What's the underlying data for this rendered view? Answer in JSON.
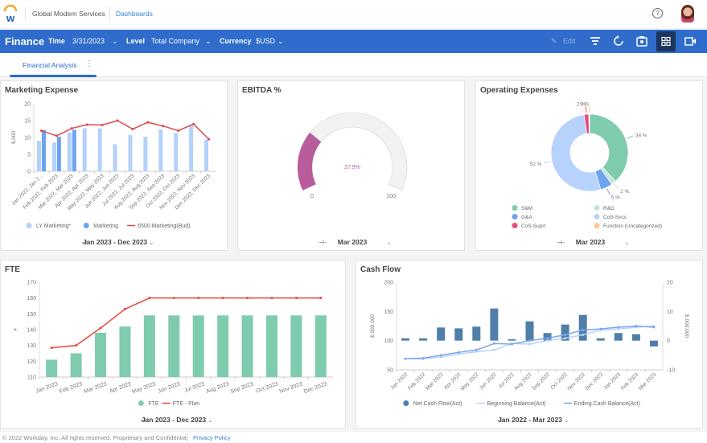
{
  "header": {
    "company": "Global Modern Services",
    "nav_link": "Dashboards",
    "help_icon": "question-circle-icon",
    "avatar": "user-avatar"
  },
  "toolbar": {
    "title": "Finance",
    "time_label": "Time",
    "time_value": "3/31/2023",
    "level_label": "Level",
    "level_value": "Total Company",
    "currency_label": "Currency",
    "currency_value": "$USD",
    "edit_label": "Edit",
    "icons": [
      "pencil-icon",
      "filter-icon",
      "refresh-icon",
      "camera-icon",
      "grid-view-icon",
      "video-icon"
    ],
    "color": "#2f6ccb"
  },
  "tabs": [
    {
      "label": "Financial Analysis",
      "active": true
    }
  ],
  "footer": {
    "copyright": "© 2022 Workday, Inc. All rights reserved. Proprietary and Confidential",
    "privacy": "Privacy Policy"
  },
  "chart_data": [
    {
      "type": "bar",
      "title": "Marketing Expense",
      "ylabel": "$,000",
      "ylim": [
        0,
        20
      ],
      "yticks": [
        "0",
        "5",
        "10",
        "15",
        "20"
      ],
      "categories": [
        "Jan 2022, Jan 2...",
        "Feb 2022, Feb 2023",
        "Mar 2022, Mar 2023",
        "Apr 2022, Apr 2023",
        "May 2022, May 2023",
        "Jun 2022, Jun 2023",
        "Jul 2022, Jul 2023",
        "Aug 2022, Aug 2023",
        "Sep 2022, Sep 2023",
        "Oct 2022, Oct 2023",
        "Nov 2022, Nov 2023",
        "Dec 2022, Dec 2023"
      ],
      "series": [
        {
          "name": "LY Marketing*",
          "type": "bar",
          "color": "#b3d1fb",
          "values": [
            9,
            8.5,
            11.5,
            12.7,
            12.7,
            8,
            10.7,
            10.2,
            12.4,
            11.3,
            13.5,
            9.4
          ]
        },
        {
          "name": "Marketing",
          "type": "bar",
          "color": "#6ea3f0",
          "values": [
            12.2,
            10.2,
            12.3,
            null,
            null,
            null,
            null,
            null,
            null,
            null,
            null,
            null
          ]
        },
        {
          "name": "6500 Marketing(Bud)",
          "type": "line",
          "color": "#e0474c",
          "values": [
            12,
            10.5,
            12.7,
            13.8,
            13.7,
            15,
            12.5,
            14.5,
            13.4,
            12,
            14,
            9.5
          ]
        }
      ],
      "legend": "bottom",
      "period": "Jan 2023 - Dec 2023"
    },
    {
      "type": "gauge",
      "title": "EBITDA %",
      "value": 27.9,
      "value_label": "27.9%",
      "min_label": "0",
      "max_label": "100",
      "color": "#b85c9c",
      "period": "Mar 2023"
    },
    {
      "type": "pie",
      "title": "Operating Expenses",
      "donut": true,
      "slices": [
        {
          "name": "S&M",
          "value": 38,
          "label": "38 %",
          "color": "#7fcbad"
        },
        {
          "name": "R&D",
          "value": 2,
          "label": "2 %",
          "color": "#bfe8d8"
        },
        {
          "name": "G&A",
          "value": 5,
          "label": "5 %",
          "color": "#6ea3f0"
        },
        {
          "name": "CoS-Svcs",
          "value": 52,
          "label": "52 %",
          "color": "#b8d3fb"
        },
        {
          "name": "CoS-Suprt",
          "value": 2,
          "label": "2 %",
          "color": "#e34d7d"
        },
        {
          "name": "Function (Uncategorized)",
          "value": 0.3,
          "label": "0 %",
          "color": "#f5c98f"
        }
      ],
      "legend": "bottom",
      "period": "Mar 2023"
    },
    {
      "type": "bar",
      "title": "FTE",
      "ylabel": "#",
      "ylim": [
        110,
        170
      ],
      "yticks": [
        "110",
        "120",
        "130",
        "140",
        "150",
        "160",
        "170"
      ],
      "categories": [
        "Jan 2023",
        "Feb 2023",
        "Mar 2023",
        "Apr 2023",
        "May 2023",
        "Jun 2023",
        "Jul 2023",
        "Aug 2023",
        "Sep 2023",
        "Oct 2023",
        "Nov 2023",
        "Dec 2023"
      ],
      "series": [
        {
          "name": "FTE",
          "type": "bar",
          "color": "#7fcbad",
          "values": [
            121,
            125,
            138,
            142,
            149,
            149,
            149,
            149,
            149,
            149,
            149,
            149
          ]
        },
        {
          "name": "FTE - Plan",
          "type": "line",
          "color": "#f04438",
          "values": [
            128.5,
            130,
            141,
            153,
            160,
            160,
            160,
            160,
            160,
            160,
            160,
            160
          ]
        }
      ],
      "legend": "bottom",
      "period": "Jan 2023 - Dec 2023"
    },
    {
      "type": "bar",
      "title": "Cash Flow",
      "ylabel": "$,000,000",
      "ylabel_right": "$,000,000",
      "ylim": [
        50,
        200
      ],
      "ylim_right": [
        -10,
        20
      ],
      "yticks": [
        "50",
        "100",
        "150",
        "200"
      ],
      "yticks_right": [
        "-10",
        "0",
        "10",
        "20"
      ],
      "categories": [
        "Jan 2022",
        "Feb 2022",
        "Mar 2022",
        "Apr 2022",
        "May 2022",
        "Jun 2022",
        "Jul 2022",
        "Aug 2022",
        "Sep 2022",
        "Oct 2022",
        "Nov 2022",
        "Dec 2022",
        "Jan 2023",
        "Feb 2023",
        "Mar 2023"
      ],
      "series": [
        {
          "name": "Net Cash Flow(Act)",
          "type": "bar",
          "axis": "right",
          "color": "#4f7fa8",
          "values": [
            0.8,
            0.8,
            4.5,
            4.2,
            4.8,
            11,
            0.5,
            6.6,
            2.6,
            5.5,
            8.8,
            0.8,
            2.6,
            2.2,
            -2
          ]
        },
        {
          "name": "Beginning Balance(Act)",
          "type": "line",
          "axis": "left",
          "color": "#b8d3fb",
          "values": [
            69,
            69,
            72,
            77,
            81,
            84,
            95,
            94,
            100,
            104,
            110,
            118,
            120,
            123,
            125
          ]
        },
        {
          "name": "Ending Cash Balance(Act)",
          "type": "line",
          "axis": "left",
          "color": "#7aa6f0",
          "values": [
            69,
            70,
            75,
            80,
            84,
            95,
            94,
            100,
            104,
            110,
            118,
            120,
            123,
            125,
            123
          ]
        }
      ],
      "legend": "bottom",
      "period": "Jan 2022 - Mar 2023"
    }
  ]
}
